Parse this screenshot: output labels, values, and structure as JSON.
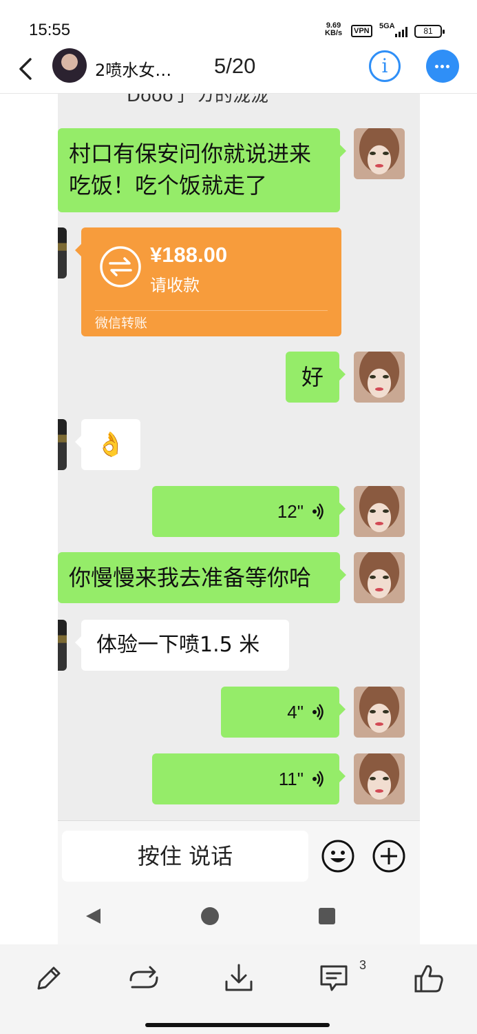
{
  "status_bar": {
    "time": "15:55",
    "speed_value": "9.69",
    "speed_unit": "KB/s",
    "vpn": "VPN",
    "network": "5GA",
    "battery": "81"
  },
  "header": {
    "title": "2喷水女…",
    "counter": "5/20",
    "accent_color": "#2f8ff7"
  },
  "chat": {
    "cut_off_text": "Dooo了 ガ的泷泷",
    "messages": [
      {
        "side": "right",
        "type": "text",
        "text_line1": "村口有保安问你就说进来",
        "text_line2": "吃饭！吃个饭就走了"
      },
      {
        "side": "left",
        "type": "transfer",
        "amount": "¥188.00",
        "status": "请收款",
        "footer": "微信转账"
      },
      {
        "side": "right",
        "type": "text",
        "text": "好"
      },
      {
        "side": "left",
        "type": "emoji",
        "text": "👌"
      },
      {
        "side": "right",
        "type": "voice",
        "duration": "12\""
      },
      {
        "side": "right",
        "type": "text",
        "text": "你慢慢来我去准备等你哈"
      },
      {
        "side": "left",
        "type": "text",
        "text": "体验一下喷1.5 米"
      },
      {
        "side": "right",
        "type": "voice",
        "duration": "4\""
      },
      {
        "side": "right",
        "type": "voice",
        "duration": "11\""
      }
    ],
    "input": {
      "talk_label": "按住 说话"
    }
  },
  "toolbar": {
    "comment_count": "3",
    "icons": [
      "edit-icon",
      "share-icon",
      "download-icon",
      "comment-icon",
      "like-icon"
    ]
  },
  "colors": {
    "green_bubble": "#95ec69",
    "transfer": "#f79c3c",
    "chat_bg": "#ededed"
  }
}
